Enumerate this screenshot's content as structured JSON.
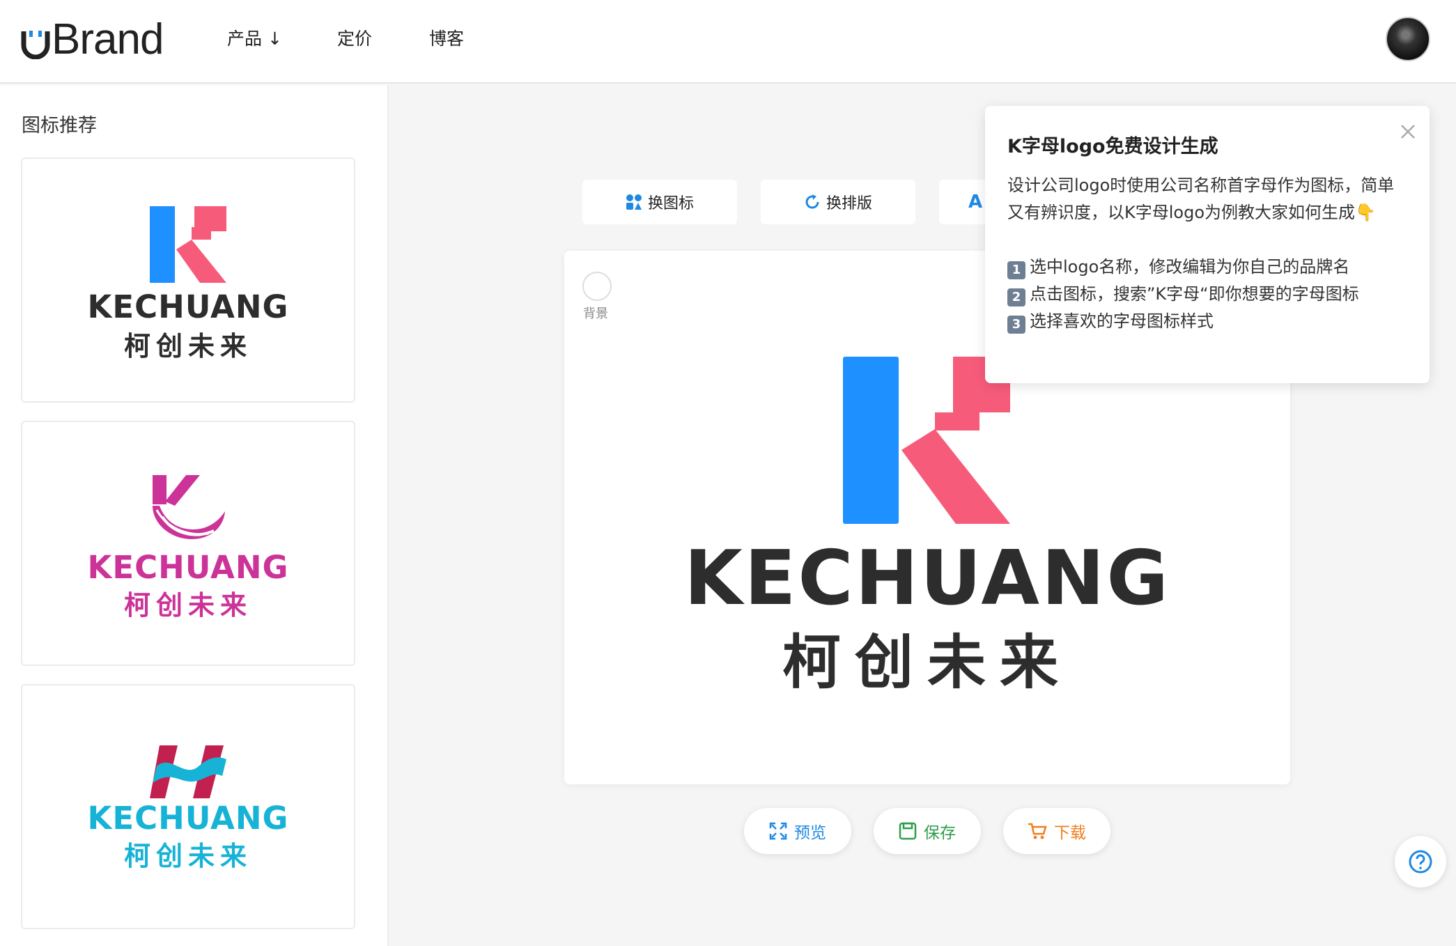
{
  "header": {
    "brand": "Brand",
    "nav": [
      {
        "label": "产品 ↓"
      },
      {
        "label": "定价"
      },
      {
        "label": "博客"
      }
    ]
  },
  "sidebar": {
    "title": "图标推荐",
    "cards": [
      {
        "en": "KECHUANG",
        "zh": "柯创未来",
        "color": "#2d2d2d",
        "icon": "k-block-icon"
      },
      {
        "en": "KECHUANG",
        "zh": "柯创未来",
        "color": "#cc3399",
        "icon": "k-swoosh-icon"
      },
      {
        "en": "KECHUANG",
        "zh": "柯创未来",
        "color": "#17b3d6",
        "icon": "h-ribbon-icon"
      }
    ]
  },
  "toolbar": {
    "change_icon": "换图标",
    "change_layout": "换排版",
    "third_partial": "A"
  },
  "canvas": {
    "bg_label": "背景",
    "en": "KECHUANG",
    "zh": "柯创未来"
  },
  "actions": {
    "preview": "预览",
    "save": "保存",
    "download": "下载"
  },
  "popover": {
    "title": "K字母logo免费设计生成",
    "intro": "设计公司logo时使用公司名称首字母作为图标，简单又有辨识度，以K字母logo为例教大家如何生成👇",
    "steps": [
      {
        "num": "1",
        "text": "选中logo名称，修改编辑为你自己的品牌名"
      },
      {
        "num": "2",
        "text": "点击图标，搜索”K字母“即你想要的字母图标"
      },
      {
        "num": "3",
        "text": "选择喜欢的字母图标样式"
      }
    ]
  },
  "colors": {
    "blue": "#1e90ff",
    "pink": "#f75b7a",
    "magenta": "#cc3399",
    "cyan": "#17b3d6",
    "crimson": "#c2214f",
    "preview_blue": "#1e88e5",
    "save_green": "#2e9d4a",
    "download_orange": "#f07d1d"
  }
}
